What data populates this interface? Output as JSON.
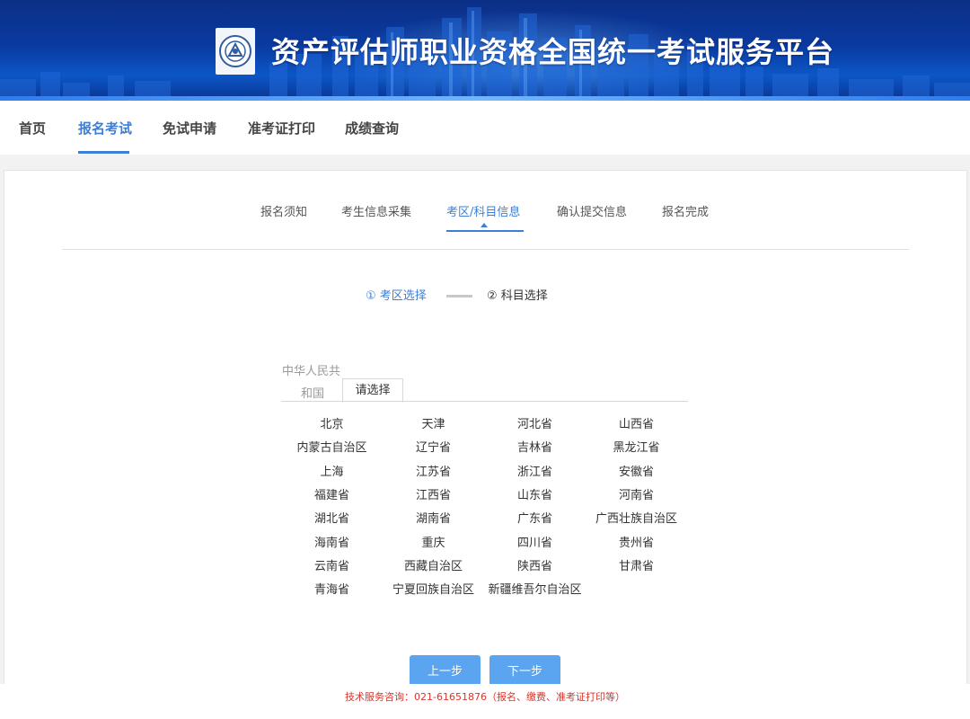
{
  "banner": {
    "title": "资产评估师职业资格全国统一考试服务平台",
    "logo_icon": "association-seal-logo"
  },
  "topnav": {
    "items": [
      {
        "label": "首页",
        "active": false
      },
      {
        "label": "报名考试",
        "active": true
      },
      {
        "label": "免试申请",
        "active": false
      },
      {
        "label": "准考证打印",
        "active": false
      },
      {
        "label": "成绩查询",
        "active": false
      }
    ]
  },
  "steps": {
    "items": [
      "报名须知",
      "考生信息采集",
      "考区/科目信息",
      "确认提交信息",
      "报名完成"
    ],
    "active_index": 2
  },
  "substeps": {
    "first": "① 考区选择",
    "second": "② 科目选择"
  },
  "picker": {
    "country_line1": "中华人民共",
    "country_line2": "和国",
    "active_tab": "请选择",
    "regions": [
      "北京",
      "天津",
      "河北省",
      "山西省",
      "内蒙古自治区",
      "辽宁省",
      "吉林省",
      "黑龙江省",
      "上海",
      "江苏省",
      "浙江省",
      "安徽省",
      "福建省",
      "江西省",
      "山东省",
      "河南省",
      "湖北省",
      "湖南省",
      "广东省",
      "广西壮族自治区",
      "海南省",
      "重庆",
      "四川省",
      "贵州省",
      "云南省",
      "西藏自治区",
      "陕西省",
      "甘肃省",
      "青海省",
      "宁夏回族自治区",
      "新疆维吾尔自治区"
    ]
  },
  "buttons": {
    "prev": "上一步",
    "next": "下一步"
  },
  "footer": {
    "text": "技术服务咨询：021-61651876（报名、缴费、准考证打印等）"
  },
  "colors": {
    "accent": "#3d7fd6",
    "button": "#5ba4ef",
    "banner": "#0a3aa0",
    "footer_text": "#d9332b"
  }
}
